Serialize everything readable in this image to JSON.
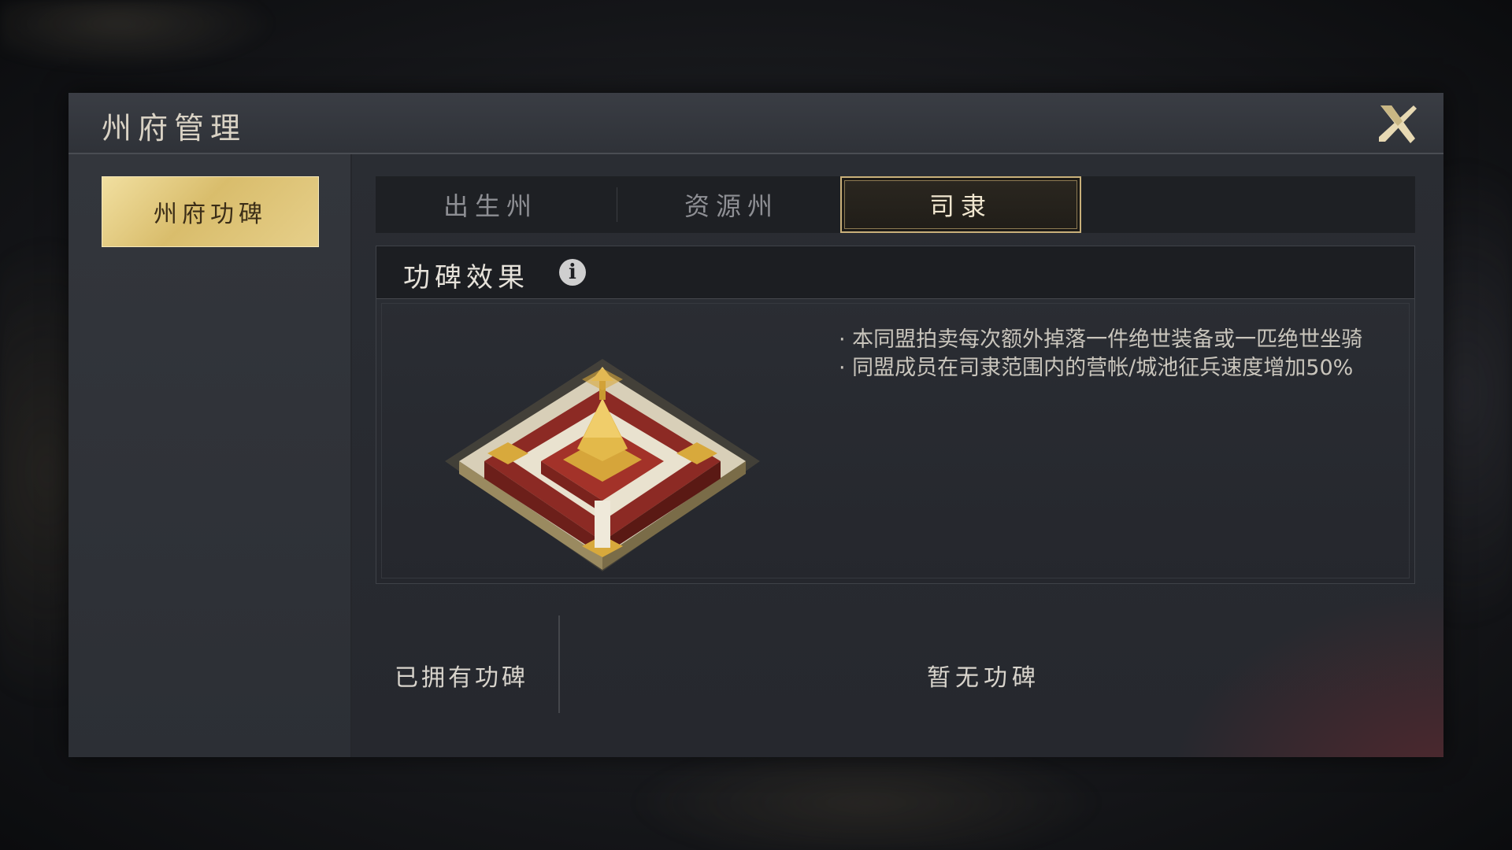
{
  "window": {
    "title": "州府管理",
    "close_icon": "close-x-icon"
  },
  "sidebar": {
    "items": [
      {
        "label": "州府功碑",
        "active": true
      }
    ]
  },
  "tabs": [
    {
      "label": "出生州",
      "active": false
    },
    {
      "label": "资源州",
      "active": false
    },
    {
      "label": "司隶",
      "active": true
    }
  ],
  "effect": {
    "title": "功碑效果",
    "info_icon": "info-icon",
    "lines": [
      "· 本同盟拍卖每次额外掉落一件绝世装备或一匹绝世坐骑",
      "· 同盟成员在司隶范围内的营帐/城池征兵速度增加50%"
    ],
    "image": "palace-building-image"
  },
  "owned": {
    "label": "已拥有功碑",
    "empty_text": "暂无功碑"
  },
  "colors": {
    "accent_gold": "#d9bd6c",
    "panel_bg": "#2b2e34",
    "active_tab_border": "#c9b07a"
  }
}
